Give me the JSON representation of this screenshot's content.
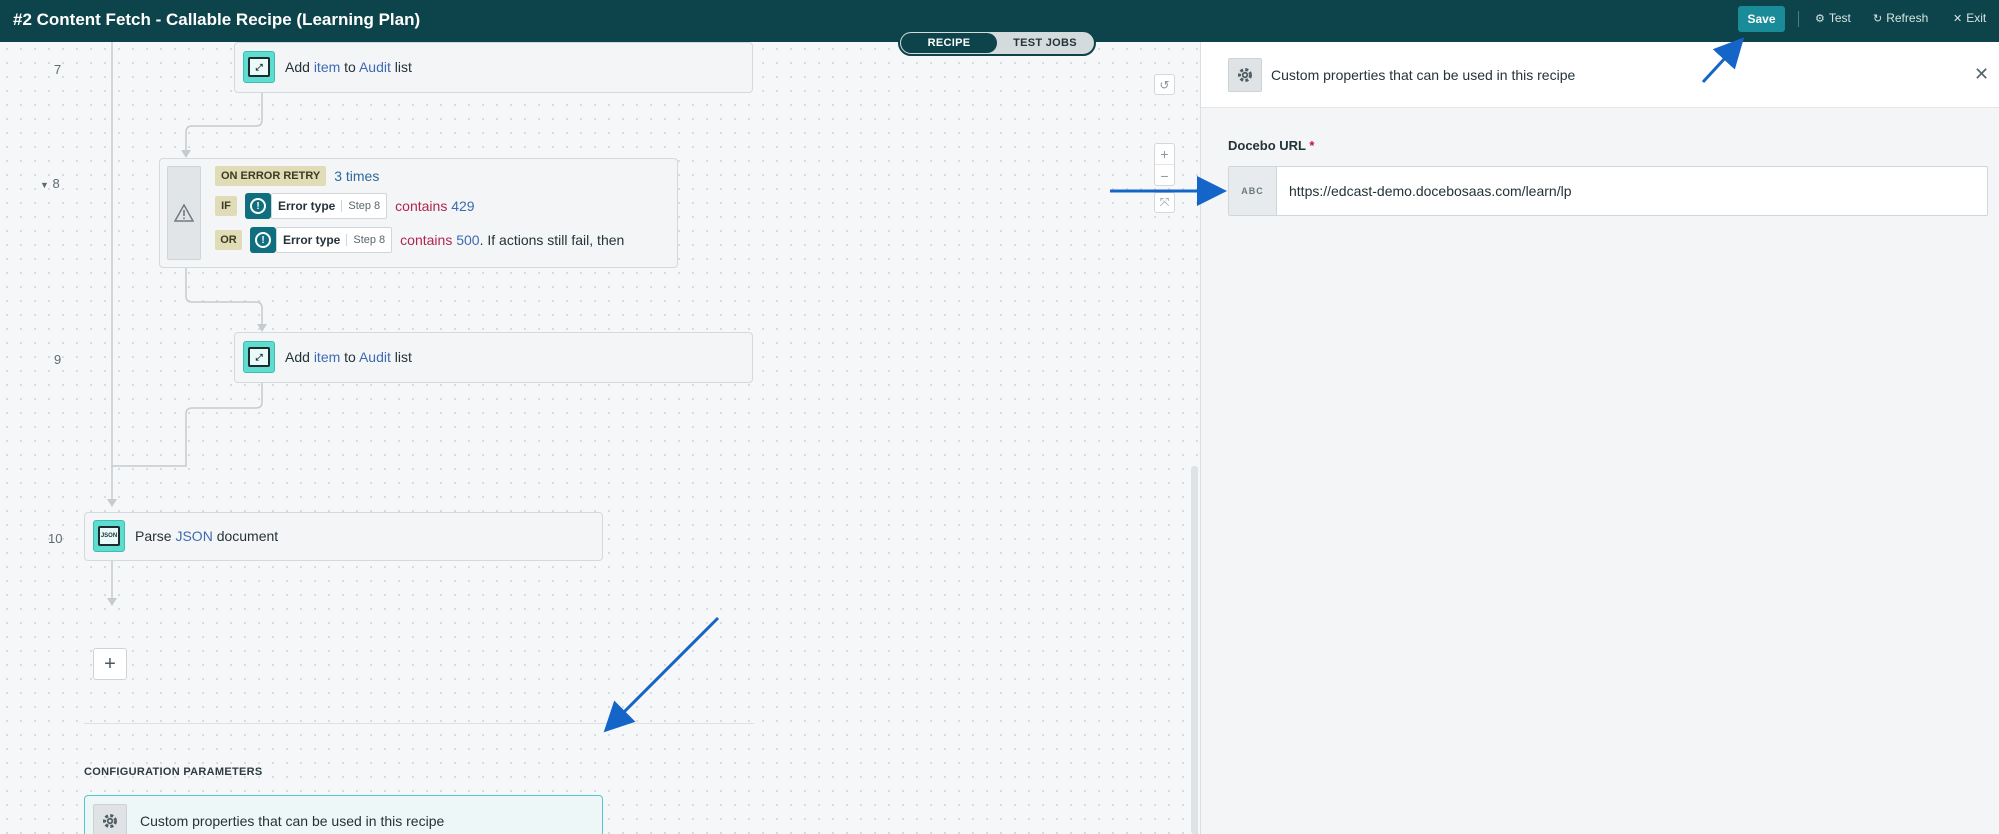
{
  "header": {
    "title": "#2 Content Fetch - Callable Recipe (Learning Plan)",
    "save_label": "Save",
    "actions": [
      {
        "icon": "gear-icon",
        "label": "Test"
      },
      {
        "icon": "refresh-icon",
        "label": "Refresh"
      },
      {
        "icon": "close-icon",
        "label": "Exit"
      }
    ]
  },
  "view_toggle": {
    "active": "RECIPE",
    "inactive": "TEST JOBS"
  },
  "steps": {
    "s7": {
      "number": "7",
      "p1": "Add",
      "p2": "item",
      "p3": "to",
      "p4": "Audit",
      "p5": "list"
    },
    "s8": {
      "number": "8",
      "retry_label": "ON ERROR RETRY",
      "retry_count": "3 times",
      "if_label": "IF",
      "or_label": "OR",
      "c1": {
        "field": "Error type",
        "step": "Step 8",
        "op": "contains",
        "value": "429"
      },
      "c2": {
        "field": "Error type",
        "step": "Step 8",
        "op": "contains",
        "value": "500",
        "suffix": ". If actions still fail, then"
      }
    },
    "s9": {
      "number": "9",
      "p1": "Add",
      "p2": "item",
      "p3": "to",
      "p4": "Audit",
      "p5": "list"
    },
    "s10": {
      "number": "10",
      "p1": "Parse",
      "p2": "JSON",
      "p3": "document",
      "icon_text": "JSON"
    }
  },
  "config": {
    "section_title": "CONFIGURATION PARAMETERS",
    "item_label": "Custom properties that can be used in this recipe"
  },
  "panel": {
    "title": "Custom properties that can be used in this recipe",
    "field_label": "Docebo URL",
    "required_mark": "*",
    "field_type": "ABC",
    "field_value": "https://edcast-demo.docebosaas.com/learn/lp"
  },
  "colors": {
    "topbar": "#0d434a",
    "accent": "#1a8b98",
    "annotation_arrow": "#1565c8"
  }
}
